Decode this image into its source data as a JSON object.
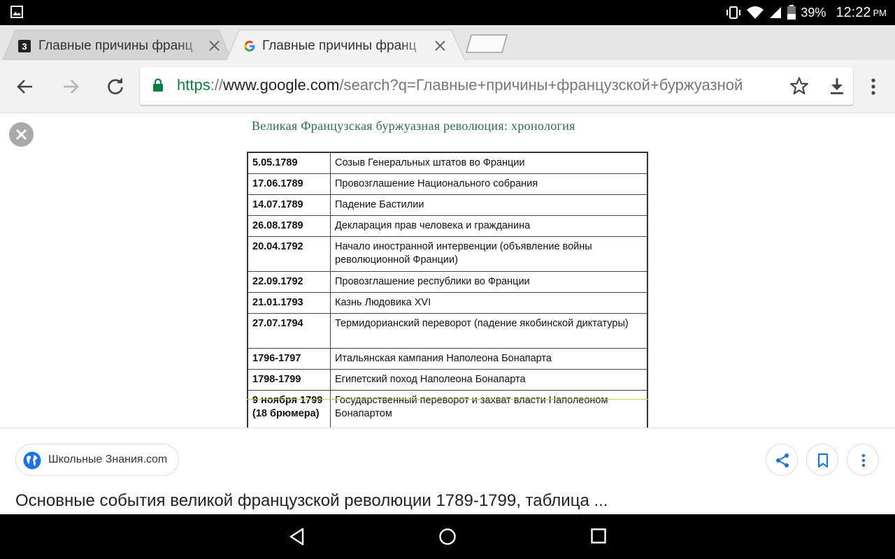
{
  "status_bar": {
    "battery": "39%",
    "time": "12:22",
    "ampm": "PM",
    "icons": [
      "gallery-icon",
      "vibrate-icon",
      "wifi-icon",
      "signal-icon",
      "battery-icon"
    ]
  },
  "tabs": [
    {
      "title": "Главные причины франц",
      "favicon": "znanija-favicon",
      "close": "✕"
    },
    {
      "title": "Главные причины франц",
      "favicon": "google-favicon",
      "close": "✕"
    }
  ],
  "toolbar": {
    "url_scheme": "https",
    "url_sep": "://",
    "url_host": "www.google.com",
    "url_path": "/search?q=Главные+причины+французской+буржуазной",
    "icons": [
      "back-icon",
      "forward-icon",
      "reload-icon",
      "lock-icon",
      "star-icon",
      "download-icon",
      "menu-icon"
    ]
  },
  "image": {
    "heading": "Великая Французская буржуазная революция: хронология",
    "rows": [
      {
        "date": "5.05.1789",
        "event": "Созыв Генеральных штатов во Франции"
      },
      {
        "date": "17.06.1789",
        "event": "Провозглашение Национального собрания"
      },
      {
        "date": "14.07.1789",
        "event": "Падение Бастилии"
      },
      {
        "date": "26.08.1789",
        "event": "Декларация прав человека и гражданина"
      },
      {
        "date": "20.04.1792",
        "event": "Начало иностранной интервенции (объявление войны революционной Франции)"
      },
      {
        "date": "22.09.1792",
        "event": "Провозглашение республики во Франции"
      },
      {
        "date": "21.01.1793",
        "event": "Казнь Людовика XVI"
      },
      {
        "date": "27.07.1794",
        "event": "Термидорианский переворот (падение якобинской диктатуры)"
      },
      {
        "date": "1796-1797",
        "event": "Итальянская кампания Наполеона Бонапарта"
      },
      {
        "date": "1798-1799",
        "event": "Египетский поход Наполеона Бонапарта"
      },
      {
        "date": "9 ноября 1799 (18 брюмера)",
        "event": "Государственный переворот и захват власти Наполеоном Бонапартом"
      }
    ]
  },
  "info": {
    "site": "Школьные Знания.com",
    "caption": "Основные события великой французской революции 1789-1799, таблица ..."
  },
  "colors": {
    "heading": "#2e6b50",
    "url_scheme": "#0b8043",
    "accent": "#1a73e8"
  }
}
